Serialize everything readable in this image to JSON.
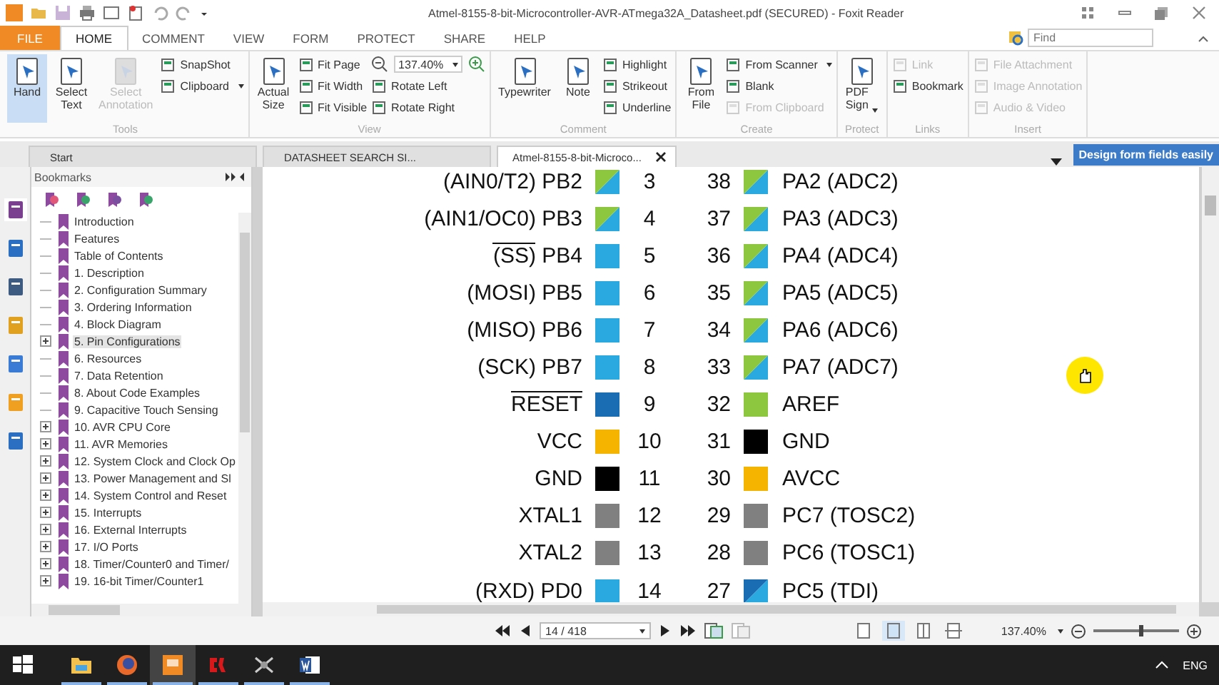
{
  "title_bar": {
    "title": "Atmel-8155-8-bit-Microcontroller-AVR-ATmega32A_Datasheet.pdf (SECURED) - Foxit Reader"
  },
  "ribbon_tabs": [
    {
      "label": "FILE",
      "kind": "file",
      "selected": false
    },
    {
      "label": "HOME",
      "kind": "tab",
      "selected": true
    },
    {
      "label": "COMMENT",
      "kind": "tab",
      "selected": false
    },
    {
      "label": "VIEW",
      "kind": "tab",
      "selected": false
    },
    {
      "label": "FORM",
      "kind": "tab",
      "selected": false
    },
    {
      "label": "PROTECT",
      "kind": "tab",
      "selected": false
    },
    {
      "label": "SHARE",
      "kind": "tab",
      "selected": false
    },
    {
      "label": "HELP",
      "kind": "tab",
      "selected": false
    }
  ],
  "find": {
    "placeholder": "Find"
  },
  "ribbon_groups": [
    {
      "label": "Tools",
      "columns": [
        {
          "kind": "large",
          "items": [
            {
              "label": "Hand",
              "selected": true,
              "disabled": false
            }
          ]
        },
        {
          "kind": "large",
          "items": [
            {
              "label": "Select Text",
              "selected": false,
              "disabled": false
            }
          ]
        },
        {
          "kind": "large",
          "items": [
            {
              "label": "Select Annotation",
              "selected": false,
              "disabled": true
            }
          ]
        },
        {
          "kind": "small",
          "items": [
            {
              "label": "SnapShot",
              "disabled": false,
              "dropdown": false
            },
            {
              "label": "Clipboard",
              "disabled": false,
              "dropdown": true
            }
          ]
        }
      ]
    },
    {
      "label": "View",
      "columns": [
        {
          "kind": "large",
          "items": [
            {
              "label": "Actual Size",
              "selected": false,
              "disabled": false
            }
          ]
        },
        {
          "kind": "small",
          "items": [
            {
              "label": "Fit Page",
              "disabled": false,
              "dropdown": false
            },
            {
              "label": "Fit Width",
              "disabled": false,
              "dropdown": false
            },
            {
              "label": "Fit Visible",
              "disabled": false,
              "dropdown": false
            }
          ]
        },
        {
          "kind": "zoom",
          "value": "137.40%",
          "items": [
            {
              "label": "Rotate Left",
              "disabled": false,
              "dropdown": false
            },
            {
              "label": "Rotate Right",
              "disabled": false,
              "dropdown": false
            }
          ]
        }
      ]
    },
    {
      "label": "Comment",
      "columns": [
        {
          "kind": "large",
          "items": [
            {
              "label": "Typewriter",
              "selected": false,
              "disabled": false
            }
          ]
        },
        {
          "kind": "large",
          "items": [
            {
              "label": "Note",
              "selected": false,
              "disabled": false
            }
          ]
        },
        {
          "kind": "small",
          "items": [
            {
              "label": "Highlight",
              "disabled": false,
              "dropdown": false
            },
            {
              "label": "Strikeout",
              "disabled": false,
              "dropdown": false
            },
            {
              "label": "Underline",
              "disabled": false,
              "dropdown": false
            }
          ]
        }
      ]
    },
    {
      "label": "Create",
      "columns": [
        {
          "kind": "large",
          "items": [
            {
              "label": "From File",
              "selected": false,
              "disabled": false
            }
          ]
        },
        {
          "kind": "small",
          "items": [
            {
              "label": "From Scanner",
              "disabled": false,
              "dropdown": true
            },
            {
              "label": "Blank",
              "disabled": false,
              "dropdown": false
            },
            {
              "label": "From Clipboard",
              "disabled": true,
              "dropdown": false
            }
          ]
        }
      ]
    },
    {
      "label": "Protect",
      "columns": [
        {
          "kind": "large",
          "items": [
            {
              "label": "PDF Sign",
              "selected": false,
              "disabled": false,
              "dropdown": true
            }
          ]
        }
      ]
    },
    {
      "label": "Links",
      "columns": [
        {
          "kind": "small",
          "items": [
            {
              "label": "Link",
              "disabled": true,
              "dropdown": false
            },
            {
              "label": "Bookmark",
              "disabled": false,
              "dropdown": false
            }
          ]
        }
      ]
    },
    {
      "label": "Insert",
      "columns": [
        {
          "kind": "small",
          "items": [
            {
              "label": "File Attachment",
              "disabled": true,
              "dropdown": false
            },
            {
              "label": "Image Annotation",
              "disabled": true,
              "dropdown": false
            },
            {
              "label": "Audio & Video",
              "disabled": true,
              "dropdown": false
            }
          ]
        }
      ]
    }
  ],
  "doc_tabs": [
    {
      "label": "Start",
      "selected": false,
      "closable": false
    },
    {
      "label": "DATASHEET SEARCH SI...",
      "selected": false,
      "closable": false
    },
    {
      "label": "Atmel-8155-8-bit-Microco...",
      "selected": true,
      "closable": true
    }
  ],
  "banner": {
    "text": "Design form fields easily"
  },
  "bookmarks": {
    "title": "Bookmarks",
    "items": [
      {
        "label": "Introduction",
        "kind": "leaf",
        "selected": false
      },
      {
        "label": "Features",
        "kind": "leaf",
        "selected": false
      },
      {
        "label": "Table of Contents",
        "kind": "leaf",
        "selected": false
      },
      {
        "label": "1. Description",
        "kind": "leaf",
        "selected": false
      },
      {
        "label": "2. Configuration Summary",
        "kind": "leaf",
        "selected": false
      },
      {
        "label": "3. Ordering Information",
        "kind": "leaf",
        "selected": false
      },
      {
        "label": "4. Block Diagram",
        "kind": "leaf",
        "selected": false
      },
      {
        "label": "5. Pin Configurations",
        "kind": "branch",
        "selected": true
      },
      {
        "label": "6. Resources",
        "kind": "leaf",
        "selected": false
      },
      {
        "label": "7. Data Retention",
        "kind": "leaf",
        "selected": false
      },
      {
        "label": "8. About Code Examples",
        "kind": "leaf",
        "selected": false
      },
      {
        "label": "9. Capacitive Touch Sensing",
        "kind": "leaf",
        "selected": false
      },
      {
        "label": "10. AVR CPU Core",
        "kind": "branch",
        "selected": false
      },
      {
        "label": "11. AVR Memories",
        "kind": "branch",
        "selected": false
      },
      {
        "label": "12. System Clock and Clock Op",
        "kind": "branch",
        "selected": false
      },
      {
        "label": "13. Power Management and Sl",
        "kind": "branch",
        "selected": false
      },
      {
        "label": "14. System Control and Reset",
        "kind": "branch",
        "selected": false
      },
      {
        "label": "15. Interrupts",
        "kind": "branch",
        "selected": false
      },
      {
        "label": "16. External Interrupts",
        "kind": "branch",
        "selected": false
      },
      {
        "label": "17. I/O Ports",
        "kind": "branch",
        "selected": false
      },
      {
        "label": "18. Timer/Counter0 and Timer/",
        "kind": "branch",
        "selected": false
      },
      {
        "label": "19. 16-bit Timer/Counter1",
        "kind": "branch",
        "selected": false
      }
    ]
  },
  "pins": [
    {
      "left": {
        "alt": "(AIN0/T2)",
        "port": "PB2",
        "overline": false,
        "number": "3",
        "color": "#29a9e0",
        "corner": {
          "color": "#8dc63f"
        }
      },
      "right": {
        "number": "38",
        "port": "PA2",
        "alt": "(ADC2)",
        "color": "#29a9e0",
        "corner": {
          "color": "#8dc63f"
        }
      }
    },
    {
      "left": {
        "alt": "(AIN1/OC0)",
        "port": "PB3",
        "overline": false,
        "number": "4",
        "color": "#29a9e0",
        "corner": {
          "color": "#8dc63f"
        }
      },
      "right": {
        "number": "37",
        "port": "PA3",
        "alt": "(ADC3)",
        "color": "#29a9e0",
        "corner": {
          "color": "#8dc63f"
        }
      }
    },
    {
      "left": {
        "alt": "(SS)",
        "port": "PB4",
        "overline": true,
        "number": "5",
        "color": "#29a9e0"
      },
      "right": {
        "number": "36",
        "port": "PA4",
        "alt": "(ADC4)",
        "color": "#29a9e0",
        "corner": {
          "color": "#8dc63f"
        }
      }
    },
    {
      "left": {
        "alt": "(MOSI)",
        "port": "PB5",
        "overline": false,
        "number": "6",
        "color": "#29a9e0"
      },
      "right": {
        "number": "35",
        "port": "PA5",
        "alt": "(ADC5)",
        "color": "#29a9e0",
        "corner": {
          "color": "#8dc63f"
        }
      }
    },
    {
      "left": {
        "alt": "(MISO)",
        "port": "PB6",
        "overline": false,
        "number": "7",
        "color": "#29a9e0"
      },
      "right": {
        "number": "34",
        "port": "PA6",
        "alt": "(ADC6)",
        "color": "#29a9e0",
        "corner": {
          "color": "#8dc63f"
        }
      }
    },
    {
      "left": {
        "alt": "(SCK)",
        "port": "PB7",
        "overline": false,
        "number": "8",
        "color": "#29a9e0"
      },
      "right": {
        "number": "33",
        "port": "PA7",
        "alt": "(ADC7)",
        "color": "#29a9e0",
        "corner": {
          "color": "#8dc63f"
        }
      }
    },
    {
      "left": {
        "port": "RESET",
        "overline": true,
        "number": "9",
        "color": "#1b6db3"
      },
      "right": {
        "number": "32",
        "port": "AREF",
        "color": "#8dc63f"
      }
    },
    {
      "left": {
        "port": "VCC",
        "overline": false,
        "number": "10",
        "color": "#f5b400"
      },
      "right": {
        "number": "31",
        "port": "GND",
        "color": "#000000"
      }
    },
    {
      "left": {
        "port": "GND",
        "overline": false,
        "number": "11",
        "color": "#000000"
      },
      "right": {
        "number": "30",
        "port": "AVCC",
        "color": "#f5b400"
      }
    },
    {
      "left": {
        "port": "XTAL1",
        "overline": false,
        "number": "12",
        "color": "#808080"
      },
      "right": {
        "number": "29",
        "port": "PC7",
        "alt": "(TOSC2)",
        "color": "#808080"
      }
    },
    {
      "left": {
        "port": "XTAL2",
        "overline": false,
        "number": "13",
        "color": "#808080"
      },
      "right": {
        "number": "28",
        "port": "PC6",
        "alt": "(TOSC1)",
        "color": "#808080"
      }
    },
    {
      "left": {
        "alt": "(RXD)",
        "port": "PD0",
        "overline": false,
        "number": "14",
        "color": "#29a9e0"
      },
      "right": {
        "number": "27",
        "port": "PC5",
        "alt": "(TDI)",
        "color": "#29a9e0",
        "corner": {
          "color": "#1b6db3"
        }
      }
    }
  ],
  "status_bar": {
    "page": "14 / 418",
    "view_modes": [
      {
        "selected": false
      },
      {
        "selected": true
      },
      {
        "selected": false
      },
      {
        "selected": false
      }
    ],
    "zoom": "137.40%",
    "zoom_slider": {
      "level": 0.55
    }
  },
  "taskbar": {
    "apps": [
      {
        "kind": "explorer",
        "selected": false
      },
      {
        "kind": "firefox",
        "selected": false
      },
      {
        "kind": "foxit",
        "selected": true
      },
      {
        "kind": "ck",
        "selected": false
      },
      {
        "kind": "other",
        "selected": false
      },
      {
        "kind": "word",
        "selected": false
      }
    ],
    "language": "ENG"
  }
}
